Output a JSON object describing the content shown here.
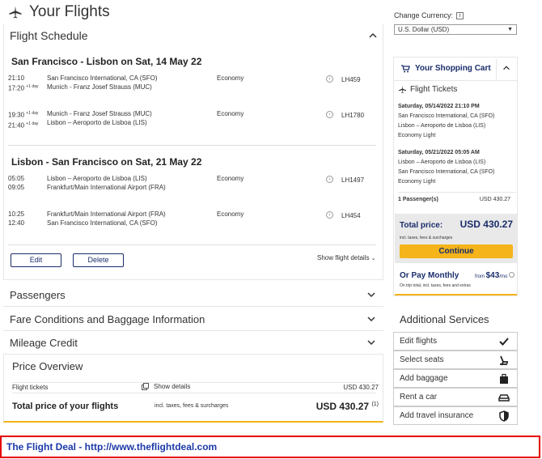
{
  "page": {
    "title": "Your Flights"
  },
  "schedule": {
    "label": "Flight Schedule",
    "outbound": {
      "route": "San Francisco - Lisbon on Sat, 14 May 22",
      "segments": [
        {
          "dep_time": "21:10",
          "arr_time": "17:20",
          "arr_sup": "+1 day",
          "dep_sup": "",
          "from": "San Francisco International, CA (SFO)",
          "to": "Munich - Franz Josef Strauss (MUC)",
          "class": "Economy",
          "flight": "LH459"
        },
        {
          "dep_time": "19:30",
          "dep_sup": "+1 day",
          "arr_time": "21:40",
          "arr_sup": "+1 day",
          "from": "Munich - Franz Josef Strauss (MUC)",
          "to": "Lisbon – Aeroporto de Lisboa (LIS)",
          "class": "Economy",
          "flight": "LH1780"
        }
      ]
    },
    "inbound": {
      "route": "Lisbon - San Francisco on Sat, 21 May 22",
      "segments": [
        {
          "dep_time": "05:05",
          "arr_time": "09:05",
          "from": "Lisbon – Aeroporto de Lisboa (LIS)",
          "to": "Frankfurt/Main International Airport (FRA)",
          "class": "Economy",
          "flight": "LH1497"
        },
        {
          "dep_time": "10:25",
          "arr_time": "12:40",
          "from": "Frankfurt/Main International Airport (FRA)",
          "to": "San Francisco International, CA (SFO)",
          "class": "Economy",
          "flight": "LH454"
        }
      ]
    },
    "edit_label": "Edit",
    "delete_label": "Delete",
    "show_details": "Show flight details"
  },
  "accordions": {
    "passengers": "Passengers",
    "fare": "Fare Conditions and Baggage Information",
    "mileage": "Mileage Credit"
  },
  "price_overview": {
    "title": "Price Overview",
    "row_label": "Flight tickets",
    "show_details": "Show details",
    "row_value": "USD 430.27",
    "total_label": "Total price of your flights",
    "total_note": "incl. taxes, fees & surcharges",
    "total_value": "USD 430.27",
    "total_sup": "(1)"
  },
  "currency": {
    "label": "Change Currency:",
    "selected": "U.S. Dollar (USD)",
    "info": "i"
  },
  "cart": {
    "title": "Your Shopping Cart",
    "section": "Flight Tickets",
    "items": [
      {
        "date": "Saturday, 05/14/2022 21:10 PM",
        "from": "San Francisco International, CA (SFO)",
        "to": "Lisbon – Aeroporto de Lisboa (LIS)",
        "fare": "Economy Light"
      },
      {
        "date": "Saturday, 05/21/2022 05:05 AM",
        "from": "Lisbon – Aeroporto de Lisboa (LIS)",
        "to": "San Francisco International, CA (SFO)",
        "fare": "Economy Light"
      }
    ],
    "passengers": "1 Passenger(s)",
    "passengers_value": "USD 430.27",
    "total_label": "Total price:",
    "total_value": "USD 430.27",
    "total_note": "incl. taxes, fees & surcharges",
    "continue": "Continue",
    "monthly_label": "Or Pay Monthly",
    "monthly_from": "from",
    "monthly_value": "$43",
    "monthly_unit": "/mo",
    "monthly_note": "On trip total, incl. taxes, fees and extras"
  },
  "services": {
    "title": "Additional Services",
    "items": [
      "Edit flights",
      "Select seats",
      "Add baggage",
      "Rent a car",
      "Add travel insurance"
    ]
  },
  "footer": {
    "text": "The Flight Deal - http://www.theflightdeal.com"
  },
  "colors": {
    "accent": "#f4b41a",
    "brand": "#1a2d6b",
    "footer_border": "#e60000",
    "footer_text": "#1c3aa8"
  }
}
